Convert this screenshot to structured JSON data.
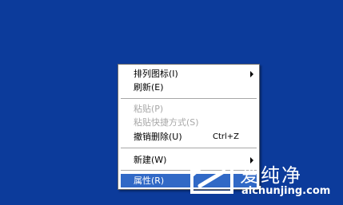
{
  "menu": {
    "items": [
      {
        "label": "排列图标(I)",
        "accel": "",
        "submenu": true,
        "disabled": false,
        "selected": false
      },
      {
        "label": "刷新(E)",
        "accel": "",
        "submenu": false,
        "disabled": false,
        "selected": false
      },
      {
        "label": "粘贴(P)",
        "accel": "",
        "submenu": false,
        "disabled": true,
        "selected": false
      },
      {
        "label": "粘贴快捷方式(S)",
        "accel": "",
        "submenu": false,
        "disabled": true,
        "selected": false
      },
      {
        "label": "撤销删除(U)",
        "accel": "Ctrl+Z",
        "submenu": false,
        "disabled": false,
        "selected": false
      },
      {
        "label": "新建(W)",
        "accel": "",
        "submenu": true,
        "disabled": false,
        "selected": false
      },
      {
        "label": "属性(R)",
        "accel": "",
        "submenu": false,
        "disabled": false,
        "selected": true
      }
    ]
  },
  "watermark": {
    "title": "爱纯净",
    "url": "aichunjing.com"
  },
  "colors": {
    "desktop": "#0c3b9b",
    "menu_bg": "#ffffff",
    "selection": "#3169c6",
    "disabled_text": "#a8a8a8"
  }
}
